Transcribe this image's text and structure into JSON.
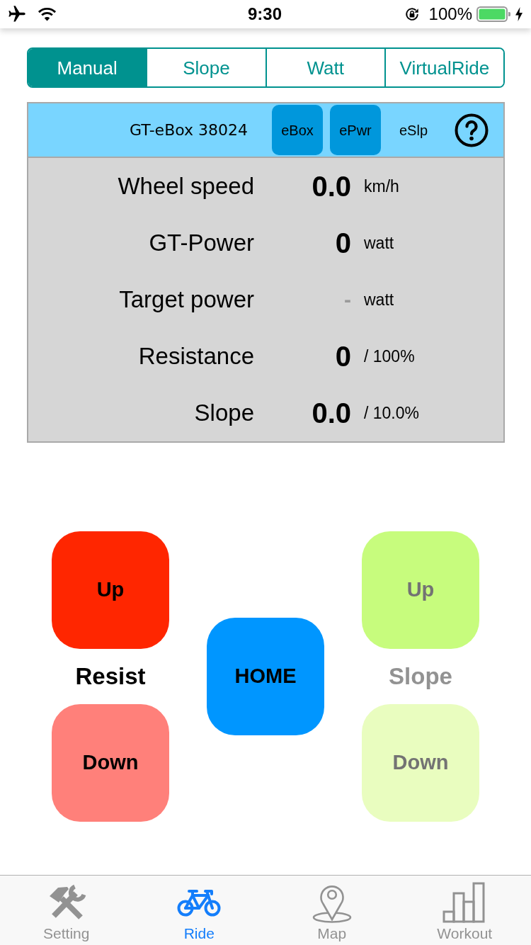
{
  "status_bar": {
    "time": "9:30",
    "battery": "100%"
  },
  "mode_tabs": [
    {
      "label": "Manual",
      "selected": true
    },
    {
      "label": "Slope",
      "selected": false
    },
    {
      "label": "Watt",
      "selected": false
    },
    {
      "label": "VirtualRide",
      "selected": false
    }
  ],
  "device_bar": {
    "name": "GT-eBox 38024",
    "toggles": [
      {
        "label": "eBox",
        "on": true
      },
      {
        "label": "ePwr",
        "on": true
      },
      {
        "label": "eSlp",
        "on": false
      }
    ]
  },
  "metrics": [
    {
      "label": "Wheel speed",
      "value": "0.0",
      "unit": "km/h",
      "muted": false
    },
    {
      "label": "GT-Power",
      "value": "0",
      "unit": "watt",
      "muted": false
    },
    {
      "label": "Target power",
      "value": "-",
      "unit": "watt",
      "muted": true
    },
    {
      "label": "Resistance",
      "value": "0",
      "unit": "/ 100%",
      "muted": false
    },
    {
      "label": "Slope",
      "value": "0.0",
      "unit": "/ 10.0%",
      "muted": false
    }
  ],
  "controls": {
    "resist": {
      "label": "Resist",
      "disabled": false,
      "up": "Up",
      "down": "Down"
    },
    "home": {
      "label": "HOME"
    },
    "slope": {
      "label": "Slope",
      "disabled": true,
      "up": "Up",
      "down": "Down"
    }
  },
  "tab_bar": [
    {
      "label": "Setting",
      "kind": "tools",
      "selected": false
    },
    {
      "label": "Ride",
      "kind": "bike",
      "selected": true
    },
    {
      "label": "Map",
      "kind": "pin",
      "selected": false
    },
    {
      "label": "Workout",
      "kind": "bars",
      "selected": false
    }
  ]
}
